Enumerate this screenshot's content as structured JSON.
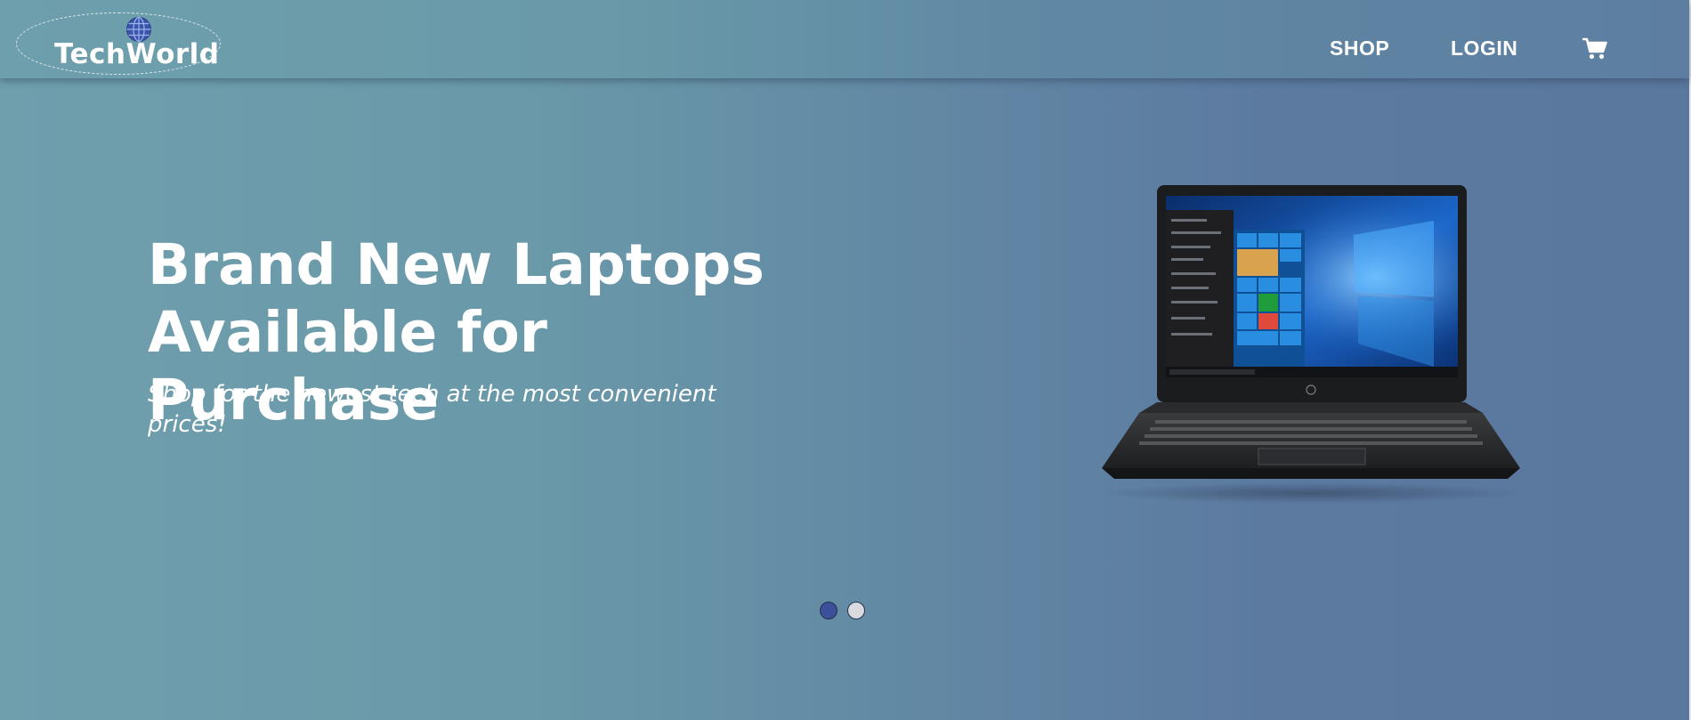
{
  "header": {
    "logo_text": "TechWorld",
    "nav": {
      "shop_label": "SHOP",
      "login_label": "LOGIN"
    },
    "icons": {
      "logo": "globe-icon",
      "cart": "shopping-cart-icon"
    }
  },
  "hero": {
    "headline_line1": "Brand New Laptops",
    "headline_line2": "Available for Purchase",
    "subheadline": "Shop for the newest tech at the most convenient prices!",
    "image": "laptop-image",
    "carousel": {
      "slide_count": 2,
      "active_slide": 1
    }
  },
  "colors": {
    "background_left": "#6f9fad",
    "background_right": "#5a779e",
    "text": "#ffffff",
    "active_dot": "#3b4f9a",
    "inactive_dot": "#d9d9de"
  }
}
